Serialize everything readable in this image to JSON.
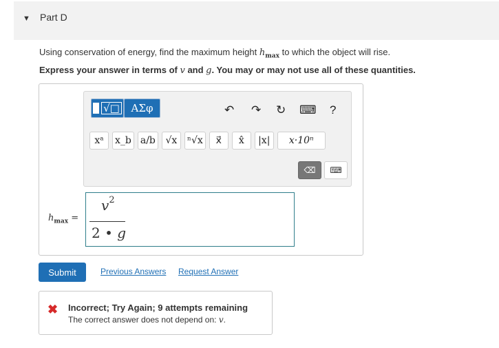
{
  "part": {
    "title": "Part D",
    "caret": "▼"
  },
  "question": {
    "text_before": "Using conservation of energy, find the maximum height ",
    "symbol": "h",
    "symbol_sub": "max",
    "text_after": " to which the object will rise."
  },
  "instruction": {
    "text_before": "Express your answer in terms of ",
    "var1": "v",
    "mid": " and ",
    "var2": "g",
    "text_after": ". You may or may not use all of these quantities."
  },
  "toolbar": {
    "templates_label": "√□",
    "symbols_label": "ΑΣφ",
    "undo_icon": "↶",
    "redo_icon": "↷",
    "reset_icon": "↻",
    "keyboard_icon": "⌨",
    "help_icon": "?",
    "keys": [
      "xᵃ",
      "x_b",
      "a/b",
      "√x",
      "ⁿ√x",
      "x⃗",
      "x̂",
      "|x|",
      "x·10ⁿ"
    ],
    "delete_icon": "⌫",
    "keyboard_toggle_icon": "⌨"
  },
  "answer": {
    "label_var": "h",
    "label_sub": "max",
    "label_eq": "=",
    "numerator_var": "v",
    "numerator_exp": "2",
    "denominator_num": "2",
    "denominator_op": "•",
    "denominator_var": "g"
  },
  "actions": {
    "submit_label": "Submit",
    "previous_answers": "Previous Answers",
    "request_answer": "Request Answer"
  },
  "feedback": {
    "icon": "✖",
    "title": "Incorrect; Try Again; 9 attempts remaining",
    "detail_before": "The correct answer does not depend on: ",
    "detail_var": "v",
    "detail_after": ".",
    "status_color": "#d62a2a"
  },
  "colors": {
    "accent": "#1f6fb5",
    "header_bg": "#f2f2f2",
    "input_border": "#2e7d8a"
  }
}
